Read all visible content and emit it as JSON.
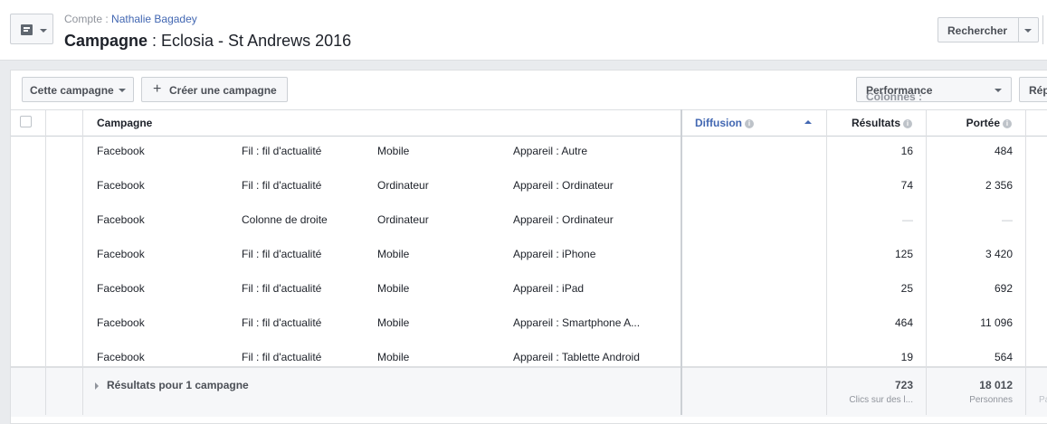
{
  "header": {
    "account_label": "Compte :",
    "account_name": "Nathalie Bagadey",
    "title_bold": "Campagne",
    "title_rest": " : Eclosia - St Andrews 2016",
    "search_button": "Rechercher"
  },
  "toolbar": {
    "campaign_filter": "Cette campagne",
    "create_plus": "+",
    "create_campaign": "Créer une campagne",
    "columns_label": "Colonnes :",
    "columns_value": "Performance",
    "rep_button": "Rép"
  },
  "table": {
    "headers": {
      "campaign": "Campagne",
      "delivery": "Diffusion",
      "results": "Résultats",
      "reach": "Portée"
    },
    "rows": [
      {
        "platform": "Facebook",
        "placement": "Fil : fil d'actualité",
        "device": "Mobile",
        "device_detail": "Appareil : Autre",
        "results": "16",
        "reach": "484"
      },
      {
        "platform": "Facebook",
        "placement": "Fil : fil d'actualité",
        "device": "Ordinateur",
        "device_detail": "Appareil : Ordinateur",
        "results": "74",
        "reach": "2 356"
      },
      {
        "platform": "Facebook",
        "placement": "Colonne de droite",
        "device": "Ordinateur",
        "device_detail": "Appareil : Ordinateur",
        "results": "—",
        "reach": "—"
      },
      {
        "platform": "Facebook",
        "placement": "Fil : fil d'actualité",
        "device": "Mobile",
        "device_detail": "Appareil : iPhone",
        "results": "125",
        "reach": "3 420"
      },
      {
        "platform": "Facebook",
        "placement": "Fil : fil d'actualité",
        "device": "Mobile",
        "device_detail": "Appareil : iPad",
        "results": "25",
        "reach": "692"
      },
      {
        "platform": "Facebook",
        "placement": "Fil : fil d'actualité",
        "device": "Mobile",
        "device_detail": "Appareil : Smartphone A...",
        "results": "464",
        "reach": "11 096"
      },
      {
        "platform": "Facebook",
        "placement": "Fil : fil d'actualité",
        "device": "Mobile",
        "device_detail": "Appareil : Tablette Android",
        "results": "19",
        "reach": "564"
      }
    ],
    "footer": {
      "label": "Résultats pour 1 campagne",
      "results_total": "723",
      "results_sub": "Clics sur des l...",
      "reach_total": "18 012",
      "reach_sub": "Personnes",
      "extra_sub": "Pa"
    }
  },
  "icons": {
    "nav": "document-icon",
    "info": "info-icon",
    "sort": "sort-ascending-icon"
  },
  "colors": {
    "link": "#4267b2",
    "background": "#e9ebee"
  }
}
